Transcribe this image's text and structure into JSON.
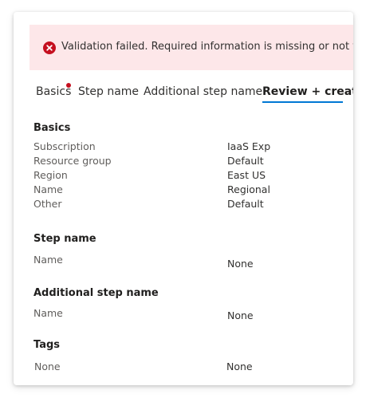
{
  "banner": {
    "message": "Validation failed. Required information is missing or not valid.",
    "icon": "error-circle-icon",
    "color": "#fde7e9"
  },
  "tabs": [
    {
      "label": "Basics",
      "has_error": true
    },
    {
      "label": "Step name",
      "has_error": false
    },
    {
      "label": "Additional step name",
      "has_error": false
    },
    {
      "label": "Review + create",
      "active": true
    }
  ],
  "sections": {
    "basics": {
      "title": "Basics",
      "rows": [
        {
          "label": "Subscription",
          "value": "IaaS Exp"
        },
        {
          "label": "Resource group",
          "value": "Default"
        },
        {
          "label": "Region",
          "value": "East US"
        },
        {
          "label": "Name",
          "value": "Regional"
        },
        {
          "label": "Other",
          "value": "Default"
        }
      ]
    },
    "step_name": {
      "title": "Step name",
      "rows": [
        {
          "label": "Name",
          "value": "None"
        }
      ]
    },
    "additional_step_name": {
      "title": "Additional step name",
      "rows": [
        {
          "label": "Name",
          "value": "None"
        }
      ]
    },
    "tags": {
      "title": "Tags",
      "rows": [
        {
          "label": "None",
          "value": "None"
        }
      ]
    }
  },
  "colors": {
    "accent": "#0078d4",
    "error": "#c50f1f"
  }
}
